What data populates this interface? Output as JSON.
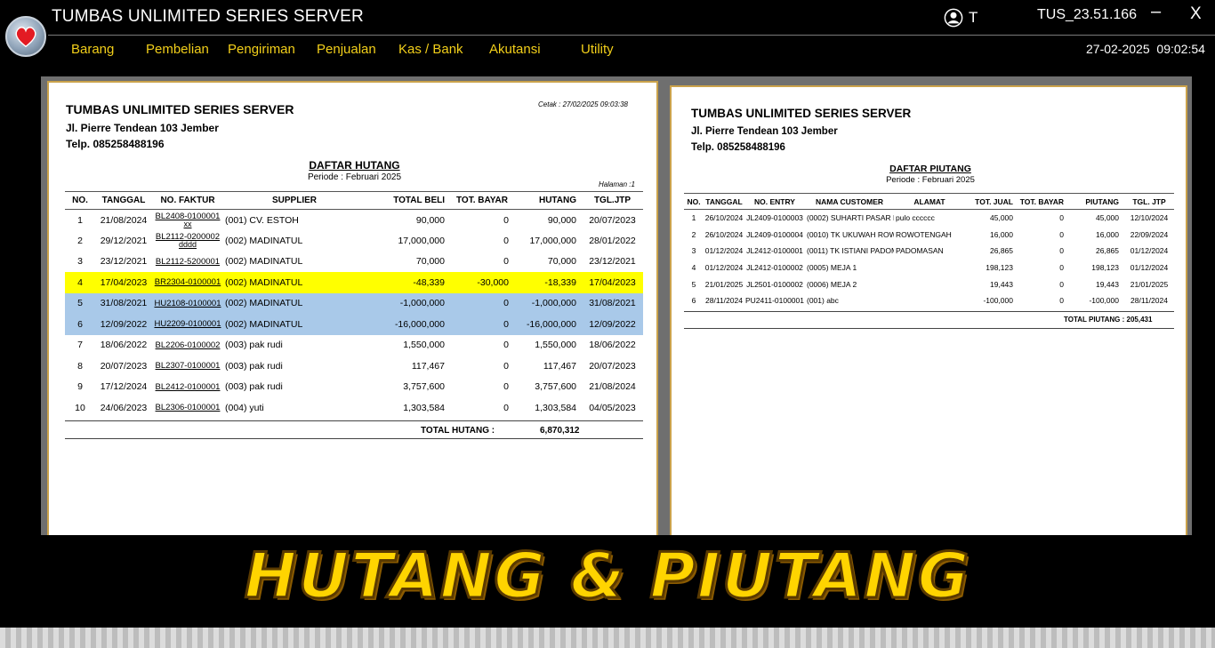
{
  "app": {
    "title": "TUMBAS UNLIMITED SERIES SERVER",
    "user": "T",
    "version": "TUS_23.51.166",
    "minimize": "–",
    "close": "X",
    "date": "27-02-2025",
    "time": "09:02:54"
  },
  "menu": [
    "Barang",
    "Pembelian",
    "Pengiriman",
    "Penjualan",
    "Kas / Bank",
    "Akutansi",
    "Utility"
  ],
  "icons": [
    "heart-logo-icon",
    "user-icon"
  ],
  "colors": {
    "menu_text": "#f2cf1a",
    "highlight_yellow": "#ffff00",
    "highlight_blue": "#a9c9e9",
    "banner_text": "#ffd400",
    "panel_border": "#caa24b"
  },
  "hutang": {
    "company": "TUMBAS UNLIMITED SERIES SERVER",
    "address": "Jl. Pierre Tendean 103 Jember",
    "phone": "Telp. 085258488196",
    "printed": "Cetak :  27/02/2025 09:03:38",
    "title": "DAFTAR HUTANG",
    "period": "Periode : Februari 2025",
    "page": "Halaman :1",
    "headers": [
      "NO.",
      "TANGGAL",
      "NO. FAKTUR",
      "SUPPLIER",
      "TOTAL BELI",
      "TOT. BAYAR",
      "HUTANG",
      "TGL.JTP"
    ],
    "rows": [
      {
        "no": "1",
        "tanggal": "21/08/2024",
        "faktur": "BL2408-0100001",
        "sub": "xx",
        "supplier": "(001) CV. ESTOH",
        "total": "90,000",
        "bayar": "0",
        "hutang": "90,000",
        "jtp": "20/07/2023",
        "hl": ""
      },
      {
        "no": "2",
        "tanggal": "29/12/2021",
        "faktur": "BL2112-0200002",
        "sub": "dddd",
        "supplier": "(002) MADINATUL",
        "total": "17,000,000",
        "bayar": "0",
        "hutang": "17,000,000",
        "jtp": "28/01/2022",
        "hl": ""
      },
      {
        "no": "3",
        "tanggal": "23/12/2021",
        "faktur": "BL2112-5200001",
        "sub": "",
        "supplier": "(002) MADINATUL",
        "total": "70,000",
        "bayar": "0",
        "hutang": "70,000",
        "jtp": "23/12/2021",
        "hl": ""
      },
      {
        "no": "4",
        "tanggal": "17/04/2023",
        "faktur": "BR2304-0100001",
        "sub": "",
        "supplier": "(002) MADINATUL",
        "total": "-48,339",
        "bayar": "-30,000",
        "hutang": "-18,339",
        "jtp": "17/04/2023",
        "hl": "yellow"
      },
      {
        "no": "5",
        "tanggal": "31/08/2021",
        "faktur": "HU2108-0100001",
        "sub": "",
        "supplier": "(002) MADINATUL",
        "total": "-1,000,000",
        "bayar": "0",
        "hutang": "-1,000,000",
        "jtp": "31/08/2021",
        "hl": "blue"
      },
      {
        "no": "6",
        "tanggal": "12/09/2022",
        "faktur": "HU2209-0100001",
        "sub": "",
        "supplier": "(002) MADINATUL",
        "total": "-16,000,000",
        "bayar": "0",
        "hutang": "-16,000,000",
        "jtp": "12/09/2022",
        "hl": "blue"
      },
      {
        "no": "7",
        "tanggal": "18/06/2022",
        "faktur": "BL2206-0100002",
        "sub": "",
        "supplier": "(003) pak rudi",
        "total": "1,550,000",
        "bayar": "0",
        "hutang": "1,550,000",
        "jtp": "18/06/2022",
        "hl": ""
      },
      {
        "no": "8",
        "tanggal": "20/07/2023",
        "faktur": "BL2307-0100001",
        "sub": "",
        "supplier": "(003) pak rudi",
        "total": "117,467",
        "bayar": "0",
        "hutang": "117,467",
        "jtp": "20/07/2023",
        "hl": ""
      },
      {
        "no": "9",
        "tanggal": "17/12/2024",
        "faktur": "BL2412-0100001",
        "sub": "",
        "supplier": "(003) pak rudi",
        "total": "3,757,600",
        "bayar": "0",
        "hutang": "3,757,600",
        "jtp": "21/08/2024",
        "hl": ""
      },
      {
        "no": "10",
        "tanggal": "24/06/2023",
        "faktur": "BL2306-0100001",
        "sub": "",
        "supplier": "(004) yuti",
        "total": "1,303,584",
        "bayar": "0",
        "hutang": "1,303,584",
        "jtp": "04/05/2023",
        "hl": ""
      }
    ],
    "total_label": "TOTAL HUTANG :",
    "total_value": "6,870,312"
  },
  "piutang": {
    "company": "TUMBAS UNLIMITED SERIES SERVER",
    "address": "Jl. Pierre Tendean 103 Jember",
    "phone": "Telp. 085258488196",
    "title": "DAFTAR PIUTANG",
    "period": "Periode : Februari 2025",
    "headers": [
      "NO.",
      "TANGGAL",
      "NO. ENTRY",
      "NAMA CUSTOMER",
      "ALAMAT",
      "TOT. JUAL",
      "TOT. BAYAR",
      "PIUTANG",
      "TGL. JTP"
    ],
    "rows": [
      {
        "no": "1",
        "tanggal": "26/10/2024",
        "entry": "JL2409-0100003",
        "customer": "(0002) SUHARTI PASAR F",
        "alamat": "pulo cccccc",
        "jual": "45,000",
        "bayar": "0",
        "piutang": "45,000",
        "jtp": "12/10/2024"
      },
      {
        "no": "2",
        "tanggal": "26/10/2024",
        "entry": "JL2409-0100004",
        "customer": "(0010) TK UKUWAH ROW",
        "alamat": "ROWOTENGAH",
        "jual": "16,000",
        "bayar": "0",
        "piutang": "16,000",
        "jtp": "22/09/2024"
      },
      {
        "no": "3",
        "tanggal": "01/12/2024",
        "entry": "JL2412-0100001",
        "customer": "(0011) TK ISTIANI PADOM",
        "alamat": "PADOMASAN",
        "jual": "26,865",
        "bayar": "0",
        "piutang": "26,865",
        "jtp": "01/12/2024"
      },
      {
        "no": "4",
        "tanggal": "01/12/2024",
        "entry": "JL2412-0100002",
        "customer": "(0005) MEJA 1",
        "alamat": "",
        "jual": "198,123",
        "bayar": "0",
        "piutang": "198,123",
        "jtp": "01/12/2024"
      },
      {
        "no": "5",
        "tanggal": "21/01/2025",
        "entry": "JL2501-0100002",
        "customer": "(0006) MEJA 2",
        "alamat": "",
        "jual": "19,443",
        "bayar": "0",
        "piutang": "19,443",
        "jtp": "21/01/2025"
      },
      {
        "no": "6",
        "tanggal": "28/11/2024",
        "entry": "PU2411-0100001",
        "customer": "(001) abc",
        "alamat": "",
        "jual": "-100,000",
        "bayar": "0",
        "piutang": "-100,000",
        "jtp": "28/11/2024"
      }
    ],
    "total_text": "TOTAL PIUTANG : 205,431"
  },
  "banner": "HUTANG & PIUTANG"
}
